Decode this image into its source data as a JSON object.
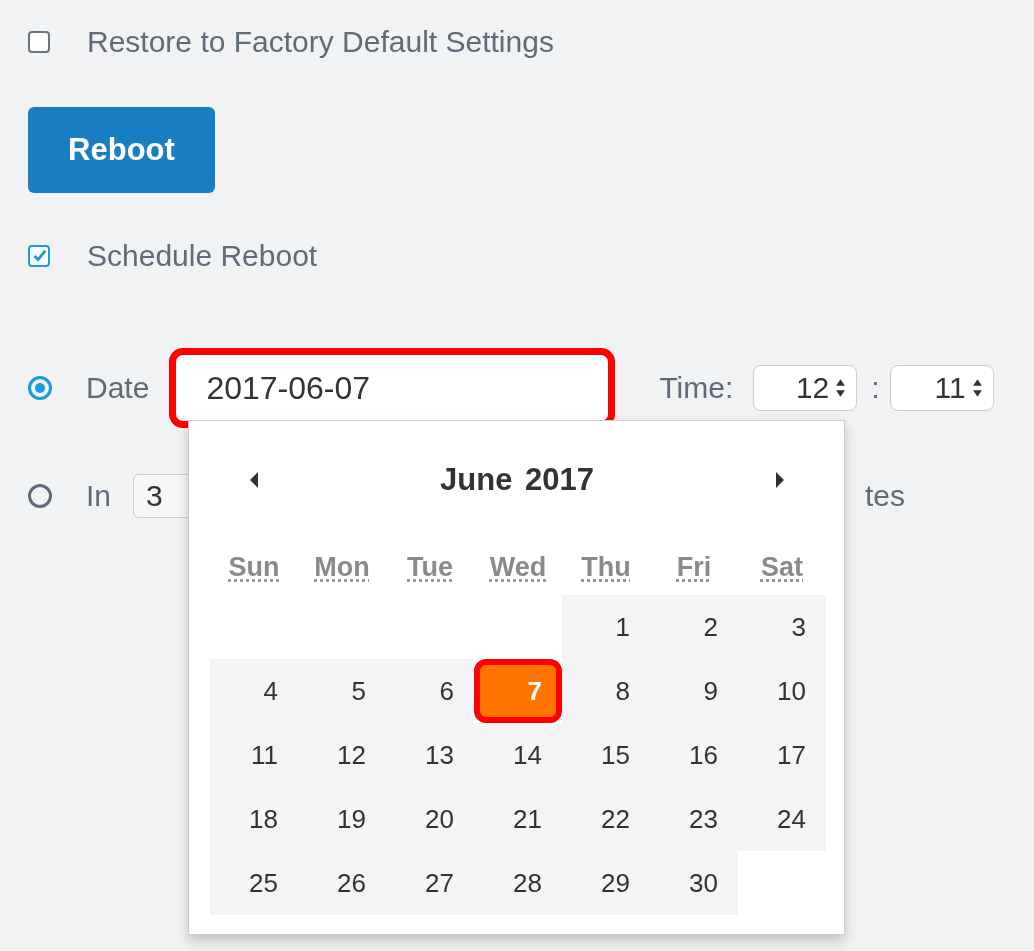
{
  "restore": {
    "label": "Restore to Factory Default Settings",
    "checked": false
  },
  "reboot_button": "Reboot",
  "schedule": {
    "label": "Schedule Reboot",
    "checked": true
  },
  "date_option": {
    "label": "Date",
    "selected": true,
    "value": "2017-06-07",
    "time_label": "Time:",
    "hour": "12",
    "separator": ":",
    "minute": "11"
  },
  "in_option": {
    "label": "In",
    "selected": false,
    "value": "3",
    "suffix": "tes"
  },
  "calendar": {
    "title": "June 2017",
    "weekdays": [
      "Sun",
      "Mon",
      "Tue",
      "Wed",
      "Thu",
      "Fri",
      "Sat"
    ],
    "days": [
      {
        "kind": "blank"
      },
      {
        "kind": "blank"
      },
      {
        "kind": "blank"
      },
      {
        "kind": "blank"
      },
      {
        "label": "1",
        "selected": false
      },
      {
        "label": "2",
        "selected": false
      },
      {
        "label": "3",
        "selected": false
      },
      {
        "label": "4",
        "selected": false
      },
      {
        "label": "5",
        "selected": false
      },
      {
        "label": "6",
        "selected": false
      },
      {
        "label": "7",
        "selected": true
      },
      {
        "label": "8",
        "selected": false
      },
      {
        "label": "9",
        "selected": false
      },
      {
        "label": "10",
        "selected": false
      },
      {
        "label": "11",
        "selected": false
      },
      {
        "label": "12",
        "selected": false
      },
      {
        "label": "13",
        "selected": false
      },
      {
        "label": "14",
        "selected": false
      },
      {
        "label": "15",
        "selected": false
      },
      {
        "label": "16",
        "selected": false
      },
      {
        "label": "17",
        "selected": false
      },
      {
        "label": "18",
        "selected": false
      },
      {
        "label": "19",
        "selected": false
      },
      {
        "label": "20",
        "selected": false
      },
      {
        "label": "21",
        "selected": false
      },
      {
        "label": "22",
        "selected": false
      },
      {
        "label": "23",
        "selected": false
      },
      {
        "label": "24",
        "selected": false
      },
      {
        "label": "25",
        "selected": false
      },
      {
        "label": "26",
        "selected": false
      },
      {
        "label": "27",
        "selected": false
      },
      {
        "label": "28",
        "selected": false
      },
      {
        "label": "29",
        "selected": false
      },
      {
        "label": "30",
        "selected": false
      }
    ]
  }
}
